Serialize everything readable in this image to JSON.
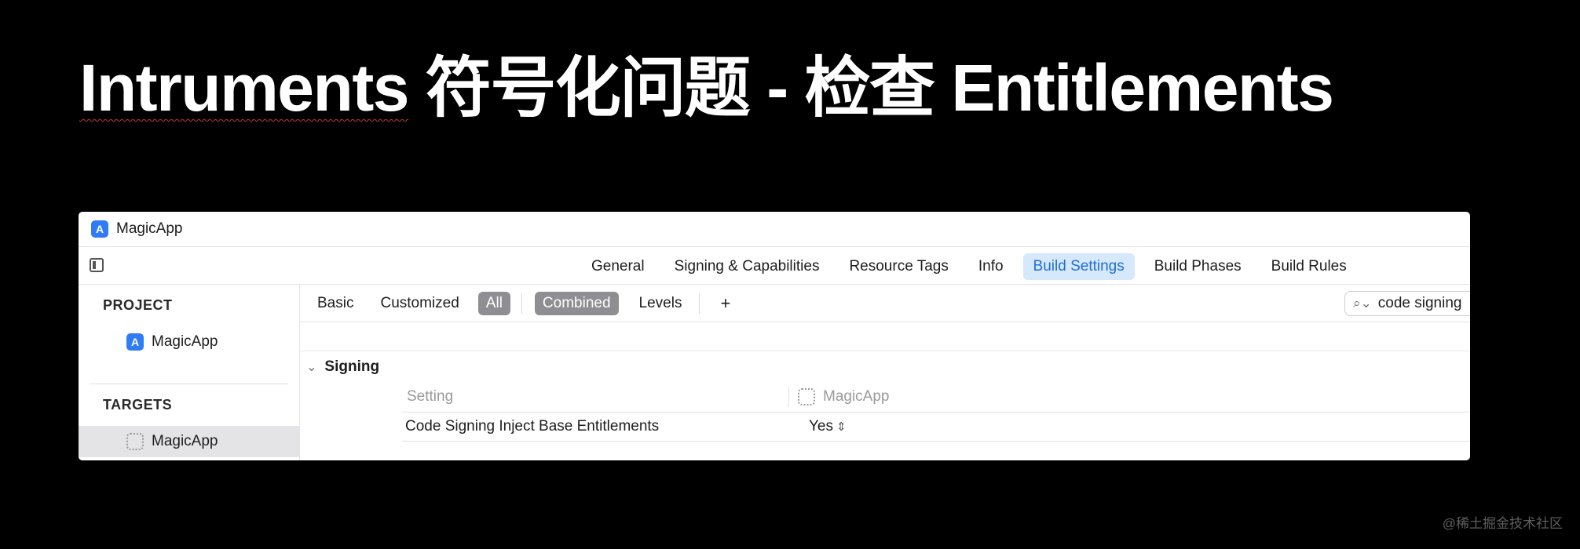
{
  "slide": {
    "title_underlined": "Intruments",
    "title_rest": " 符号化问题 - 检查 Entitlements",
    "watermark": "@稀土掘金技术社区"
  },
  "window": {
    "title": "MagicApp",
    "tabs": [
      {
        "label": "General",
        "active": false
      },
      {
        "label": "Signing & Capabilities",
        "active": false
      },
      {
        "label": "Resource Tags",
        "active": false
      },
      {
        "label": "Info",
        "active": false
      },
      {
        "label": "Build Settings",
        "active": true
      },
      {
        "label": "Build Phases",
        "active": false
      },
      {
        "label": "Build Rules",
        "active": false
      }
    ]
  },
  "sidebar": {
    "project_header": "PROJECT",
    "project_item": "MagicApp",
    "targets_header": "TARGETS",
    "target_item": "MagicApp"
  },
  "filter_bar": {
    "basic": "Basic",
    "customized": "Customized",
    "all": "All",
    "combined": "Combined",
    "levels": "Levels",
    "add": "+",
    "search_value": "code signing"
  },
  "settings": {
    "group_title": "Signing",
    "column_setting": "Setting",
    "column_target": "MagicApp",
    "rows": [
      {
        "name": "Code Signing Inject Base Entitlements",
        "value": "Yes"
      }
    ]
  },
  "colors": {
    "background": "#000000",
    "accent": "#1f6fd4",
    "active_tab_bg": "#d6e8fb",
    "app_icon": "#2f7cf6",
    "pill": "#8e8e93"
  },
  "icons": {
    "app": "app-store-a-icon",
    "target": "dotted-target-icon",
    "sidebar_toggle": "sidebar-toggle-icon",
    "search": "magnifier-icon",
    "chevron": "chevron-down-icon",
    "stepper": "up-down-stepper-icon"
  }
}
